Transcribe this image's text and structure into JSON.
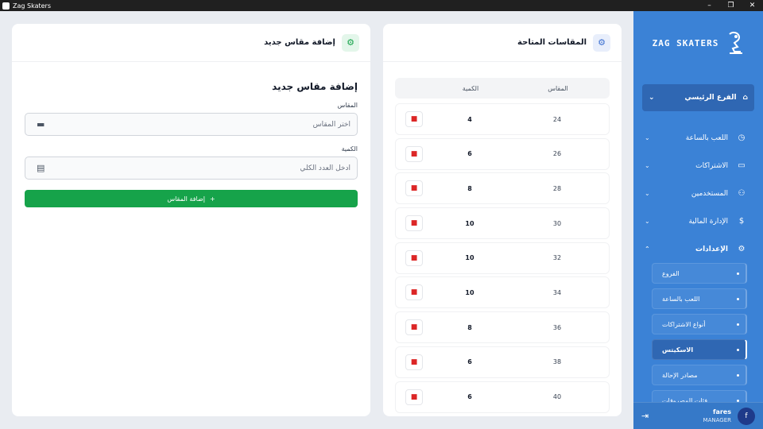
{
  "window": {
    "title": "Zag Skaters",
    "controls": [
      "–",
      "❐",
      "✕"
    ]
  },
  "sidebar": {
    "brand": "ZAG SKATERS",
    "branch": "الفرع الرئيسي",
    "nav": [
      {
        "label": "اللعب بالساعة",
        "icon": "stopwatch-icon"
      },
      {
        "label": "الاشتراكات",
        "icon": "card-icon"
      },
      {
        "label": "المستخدمين",
        "icon": "users-icon"
      },
      {
        "label": "الإدارة المالية",
        "icon": "dollar-icon"
      },
      {
        "label": "الإعدادات",
        "icon": "gear-icon"
      }
    ],
    "sub": [
      {
        "label": "الفروع"
      },
      {
        "label": "اللعب بالساعة"
      },
      {
        "label": "أنواع الاشتراكات"
      },
      {
        "label": "الاسكيتس"
      },
      {
        "label": "مصادر الإحالة"
      },
      {
        "label": "فئات المصروفات"
      }
    ],
    "user": {
      "initial": "f",
      "name": "fares",
      "role": "MANAGER"
    }
  },
  "sizes_card": {
    "title": "المقاسات المتاحة",
    "col_size": "المقاس",
    "col_qty": "الكمية",
    "rows": [
      {
        "size": "24",
        "qty": "4"
      },
      {
        "size": "26",
        "qty": "6"
      },
      {
        "size": "28",
        "qty": "8"
      },
      {
        "size": "30",
        "qty": "10"
      },
      {
        "size": "32",
        "qty": "10"
      },
      {
        "size": "34",
        "qty": "10"
      },
      {
        "size": "36",
        "qty": "8"
      },
      {
        "size": "38",
        "qty": "6"
      },
      {
        "size": "40",
        "qty": "6"
      }
    ]
  },
  "add_card": {
    "title": "إضافة مقاس جديد",
    "form_title": "إضافة مقاس جديد",
    "size_label": "المقاس",
    "size_placeholder": "اختر المقاس",
    "qty_label": "الكمية",
    "qty_placeholder": "أدخل العدد الكلي",
    "submit_label": "إضافة المقاس",
    "accent": "#16a34a"
  },
  "colors": {
    "sidebar": "#3b82d6",
    "danger": "#dc2626"
  }
}
